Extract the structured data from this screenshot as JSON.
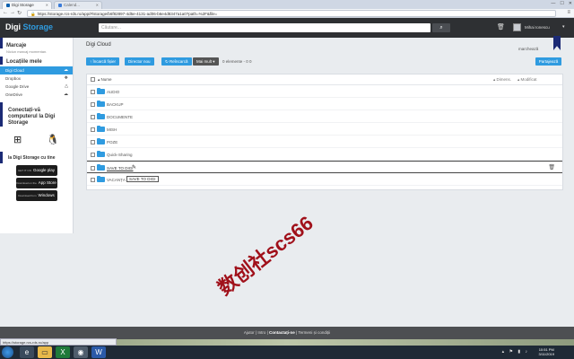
{
  "browser": {
    "tabs": [
      {
        "label": "Digi Storage",
        "active": true
      },
      {
        "label": "Calend...",
        "active": false
      }
    ],
    "url": "https://storage.rcs-rds.ro/app/#/storage/b6f82897-4d5e-4131-ad06-b6e4d8347a1a0?path=%2F&file="
  },
  "header": {
    "logo_main": "Digi",
    "logo_accent": "Storage",
    "search_placeholder": "Căutare...",
    "username": "Mihai Ionescu"
  },
  "sidebar": {
    "marcaje_title": "Marcaje",
    "marcaje_sub": "Niciun marcaj momentan.",
    "locations_title": "Locațiile mele",
    "locations": [
      {
        "label": "Digi Cloud",
        "active": true,
        "icon": "cloud-icon"
      },
      {
        "label": "Dropbox",
        "active": false,
        "icon": "dropbox-icon"
      },
      {
        "label": "Google Drive",
        "active": false,
        "icon": "google-drive-icon"
      },
      {
        "label": "OneDrive",
        "active": false,
        "icon": "onedrive-icon"
      }
    ],
    "connect_title": "Conectați-vă computerul la Digi Storage",
    "stores_title": "Ia Digi Storage cu tine",
    "stores": [
      {
        "small": "GET IT ON",
        "label": "Google play"
      },
      {
        "small": "Download on the",
        "label": "App Store"
      },
      {
        "small": "Download from",
        "label": "Windows Phone Store"
      }
    ]
  },
  "main": {
    "title": "Digi Cloud",
    "marker_label": "marchează",
    "buttons": {
      "upload": "↑ Încarcă fișier",
      "new_folder": "Director nou",
      "refresh": "↻ Reîncarcă",
      "more": "Mai mult ▾",
      "share": "Partajează"
    },
    "count_text": "0 elemente - 0 0",
    "columns": {
      "name": "▴ Nume",
      "size": "▴ Dimens.",
      "modified": "▴ Modificat"
    },
    "rows": [
      {
        "label": "AUDIO"
      },
      {
        "label": "BACKUP"
      },
      {
        "label": "DOCUMENTE"
      },
      {
        "label": "MISH"
      },
      {
        "label": "POZE"
      },
      {
        "label": "Quick-Sharing"
      },
      {
        "label": "SAVE TO DIGI",
        "editing": true
      },
      {
        "label": "VACANȚA",
        "tooltip": "SAVE TO DIGI"
      }
    ]
  },
  "footer": {
    "links": [
      "Ajutor",
      "Intro",
      "Contactați-ne",
      "Termeni și condiții"
    ],
    "status_url": "https://storage.rcs-rds.ro/app"
  },
  "taskbar": {
    "time": "10:51 PM",
    "date": "3/11/2019"
  },
  "watermark": "数创社scs66"
}
